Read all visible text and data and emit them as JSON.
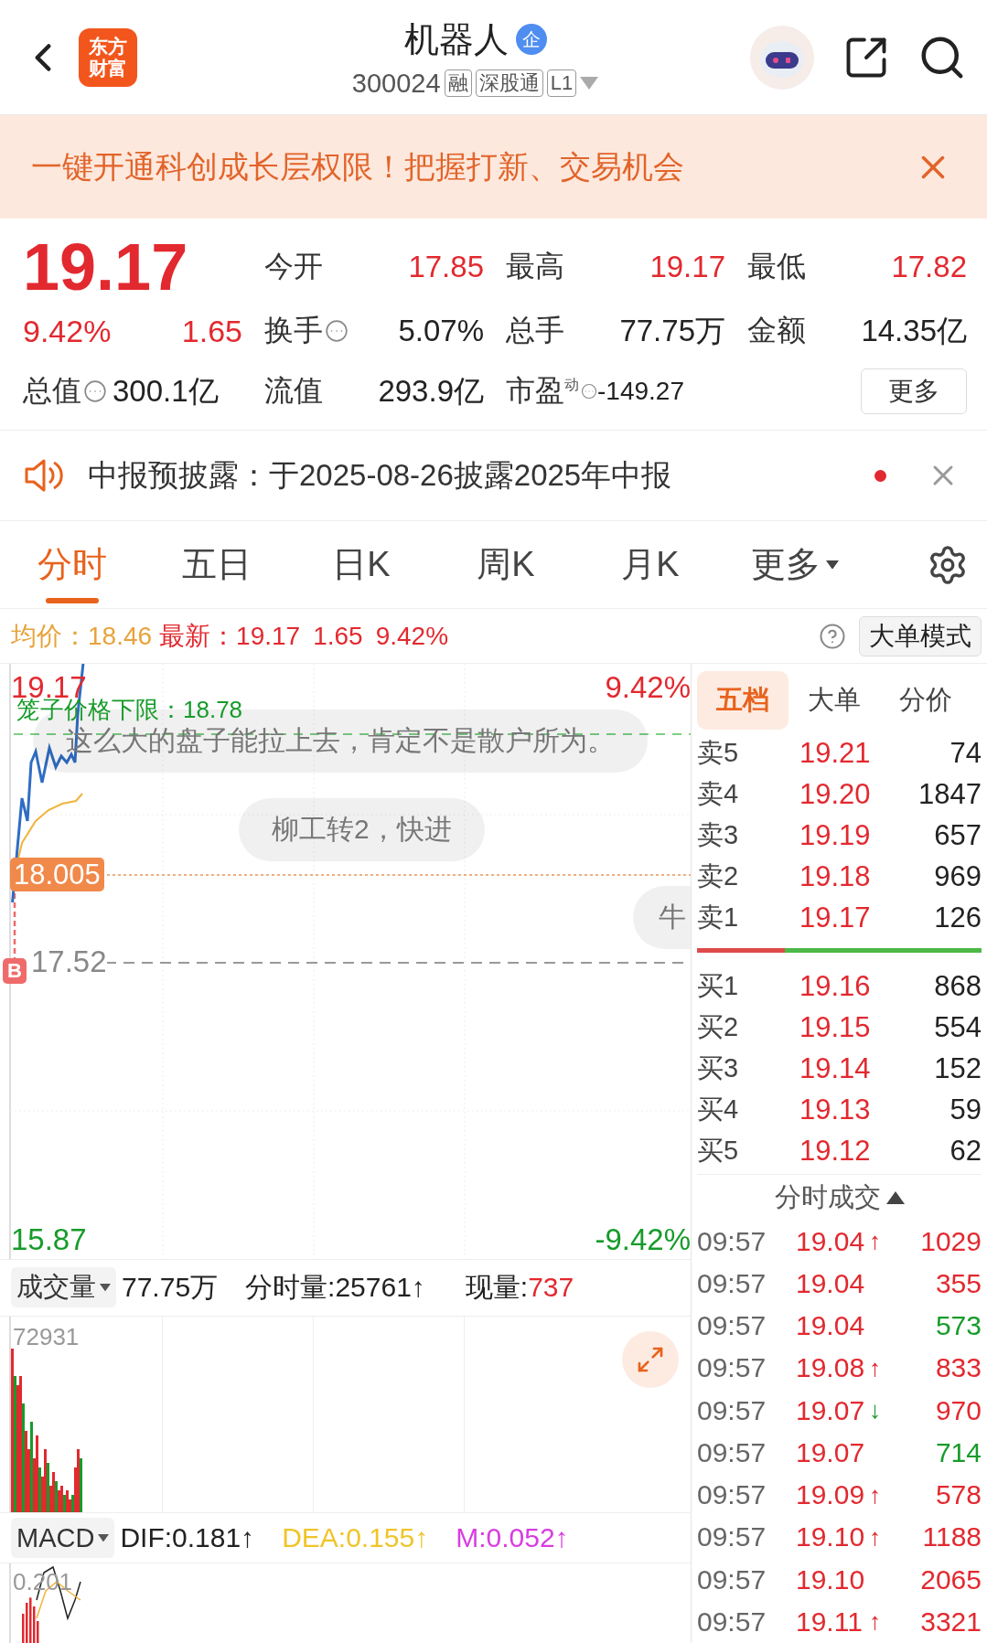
{
  "header": {
    "logo": [
      "东方",
      "财富"
    ],
    "title": "机器人",
    "title_badge": "企",
    "code": "300024",
    "tags": [
      "融",
      "深股通",
      "L1"
    ]
  },
  "banner": {
    "text": "一键开通科创成长层权限！把握打新、交易机会"
  },
  "quote": {
    "price": "19.17",
    "change_pct": "9.42%",
    "change": "1.65",
    "more_button": "更多",
    "stats": [
      {
        "label": "今开",
        "value": "17.85",
        "kind": "up",
        "info": false
      },
      {
        "label": "最高",
        "value": "19.17",
        "kind": "up",
        "info": false
      },
      {
        "label": "最低",
        "value": "17.82",
        "kind": "up",
        "info": false
      },
      {
        "label": "换手",
        "value": "5.07%",
        "kind": "flat",
        "info": true
      },
      {
        "label": "总手",
        "value": "77.75万",
        "kind": "flat",
        "info": false
      },
      {
        "label": "金额",
        "value": "14.35亿",
        "kind": "flat",
        "info": false
      },
      {
        "label": "总值",
        "value": "300.1亿",
        "kind": "flat",
        "info": true
      },
      {
        "label": "流值",
        "value": "293.9亿",
        "kind": "flat",
        "info": false
      },
      {
        "label": "市盈",
        "sup": "动",
        "value": "-149.27",
        "kind": "small",
        "info": true
      }
    ]
  },
  "notice": {
    "text": "中报预披露：于2025-08-26披露2025年中报",
    "unread": true
  },
  "tabs": [
    {
      "label": "分时",
      "selected": true,
      "kind": "tab"
    },
    {
      "label": "五日",
      "selected": false,
      "kind": "tab"
    },
    {
      "label": "日K",
      "selected": false,
      "kind": "tab"
    },
    {
      "label": "周K",
      "selected": false,
      "kind": "tab"
    },
    {
      "label": "月K",
      "selected": false,
      "kind": "tab"
    },
    {
      "label": "更多",
      "selected": false,
      "kind": "menu"
    }
  ],
  "info_line": {
    "avg": "均价：18.46",
    "latest": "最新：19.17",
    "change": "1.65",
    "change_pct": "9.42%",
    "mode_button": "大单模式"
  },
  "chart": {
    "high": "19.17",
    "high_pct": "9.42%",
    "cage": "笼子价格下限：18.78",
    "cost": "18.005",
    "mark": "17.52",
    "trade_marker": "B",
    "low": "15.87",
    "low_pct": "-9.42%",
    "comments": [
      "这么大的盘子能拉上去，肯定不是散户所为。",
      "柳工转2，快进",
      "牛"
    ]
  },
  "volume": {
    "selector": "成交量",
    "total": "77.75万",
    "minute": "分时量:25761↑",
    "current_label": "现量:",
    "current": "737",
    "max": "72931"
  },
  "macd": {
    "selector": "MACD",
    "dif": "DIF:0.181↑",
    "dea": "DEA:0.155↑",
    "m": "M:0.052↑",
    "max": "0.201"
  },
  "order_book": {
    "tabs": [
      {
        "label": "五档",
        "selected": true
      },
      {
        "label": "大单",
        "selected": false
      },
      {
        "label": "分价",
        "selected": false
      }
    ],
    "sells": [
      {
        "label": "卖5",
        "price": "19.21",
        "volume": "74"
      },
      {
        "label": "卖4",
        "price": "19.20",
        "volume": "1847"
      },
      {
        "label": "卖3",
        "price": "19.19",
        "volume": "657"
      },
      {
        "label": "卖2",
        "price": "19.18",
        "volume": "969"
      },
      {
        "label": "卖1",
        "price": "19.17",
        "volume": "126"
      }
    ],
    "ratio": {
      "level": 0.31
    },
    "buys": [
      {
        "label": "买1",
        "price": "19.16",
        "volume": "868"
      },
      {
        "label": "买2",
        "price": "19.15",
        "volume": "554"
      },
      {
        "label": "买3",
        "price": "19.14",
        "volume": "152"
      },
      {
        "label": "买4",
        "price": "19.13",
        "volume": "59"
      },
      {
        "label": "买5",
        "price": "19.12",
        "volume": "62"
      }
    ]
  },
  "trades": {
    "title": "分时成交",
    "rows": [
      {
        "time": "09:57",
        "price": "19.04",
        "arrow": {
          "text": "↑",
          "color": "#e2292f"
        },
        "volume": "1029",
        "color": "#e2292f"
      },
      {
        "time": "09:57",
        "price": "19.04",
        "volume": "355",
        "color": "#e2292f"
      },
      {
        "time": "09:57",
        "price": "19.04",
        "volume": "573",
        "color": "#179b2a"
      },
      {
        "time": "09:57",
        "price": "19.08",
        "arrow": {
          "text": "↑",
          "color": "#e2292f"
        },
        "volume": "833",
        "color": "#e2292f"
      },
      {
        "time": "09:57",
        "price": "19.07",
        "arrow": {
          "text": "↓",
          "color": "#179b2a"
        },
        "volume": "970",
        "color": "#e2292f"
      },
      {
        "time": "09:57",
        "price": "19.07",
        "volume": "714",
        "color": "#179b2a"
      },
      {
        "time": "09:57",
        "price": "19.09",
        "arrow": {
          "text": "↑",
          "color": "#e2292f"
        },
        "volume": "578",
        "color": "#e2292f"
      },
      {
        "time": "09:57",
        "price": "19.10",
        "arrow": {
          "text": "↑",
          "color": "#e2292f"
        },
        "volume": "1188",
        "color": "#e2292f"
      },
      {
        "time": "09:57",
        "price": "19.10",
        "volume": "2065",
        "color": "#e2292f"
      },
      {
        "time": "09:57",
        "price": "19.11",
        "arrow": {
          "text": "↑",
          "color": "#e2292f"
        },
        "volume": "3321",
        "color": "#e2292f"
      }
    ]
  }
}
